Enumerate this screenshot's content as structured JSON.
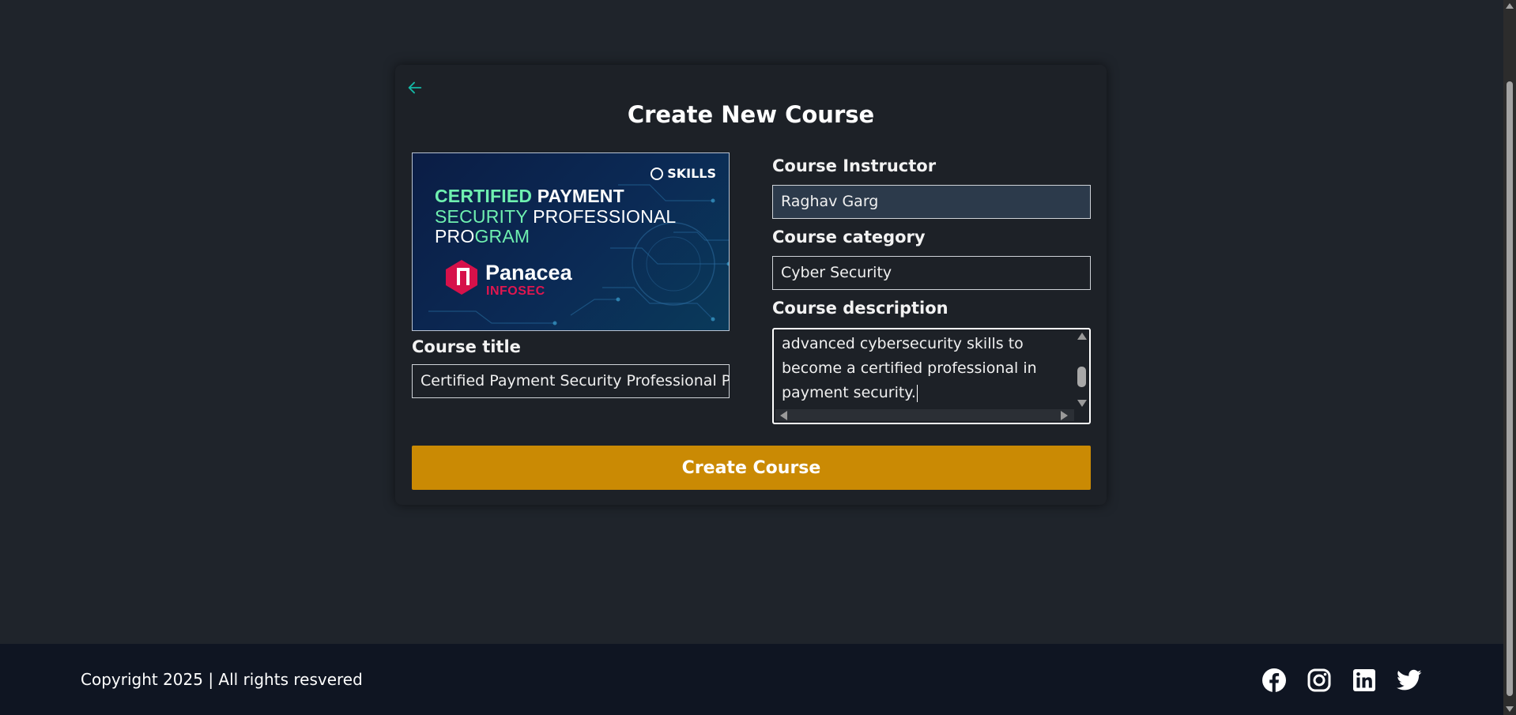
{
  "page": {
    "title": "Create New Course"
  },
  "form": {
    "back_icon": "arrow-left-icon",
    "instructor_label": "Course Instructor",
    "instructor_value": "Raghav Garg",
    "category_label": "Course category",
    "category_value": "Cyber Security",
    "description_label": "Course description",
    "description_value": "advanced cybersecurity skills to\nbecome a certified professional in\npayment security.",
    "title_label": "Course title",
    "title_value": "Certified Payment Security Professional Program",
    "submit_label": "Create Course"
  },
  "banner": {
    "skills_badge": "SKILLS",
    "line1_a": "CERTIFIED",
    "line1_b": " PAYMENT",
    "line2_a": "SECURITY",
    "line2_b": " PROFESSIONAL",
    "line3_a": "PRO",
    "line3_b": "GRAM",
    "brand": "Panacea",
    "brand_sub": "INFOSEC"
  },
  "footer": {
    "copyright": "Copyright 2025 | All rights resvered",
    "socials": [
      "facebook-icon",
      "instagram-icon",
      "linkedin-icon",
      "twitter-icon"
    ]
  },
  "colors": {
    "page_bg": "#1f242b",
    "card_bg": "#1d2127",
    "accent_teal": "#14b8a6",
    "button": "#ca8a04",
    "footer_bg": "#0f1522"
  }
}
